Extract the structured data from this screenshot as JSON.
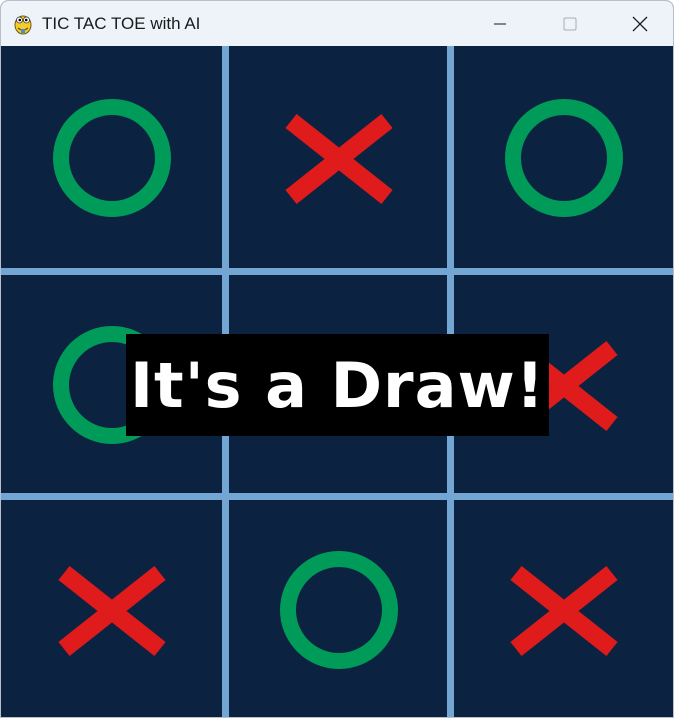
{
  "window": {
    "title": "TIC TAC TOE with AI",
    "app_icon": "pygame-snake-icon",
    "controls": [
      "minimize-icon",
      "maximize-icon",
      "close-icon"
    ]
  },
  "board": {
    "cells": [
      [
        "O",
        "X",
        "O"
      ],
      [
        "O",
        "",
        "X"
      ],
      [
        "X",
        "O",
        "X"
      ]
    ]
  },
  "status": {
    "message": "It's a Draw!"
  },
  "colors": {
    "background": "#0b2340",
    "grid_line": "#74a6d3",
    "x_mark": "#e01b1b",
    "o_mark": "#009b58",
    "banner_bg": "#000000",
    "banner_text": "#ffffff"
  }
}
